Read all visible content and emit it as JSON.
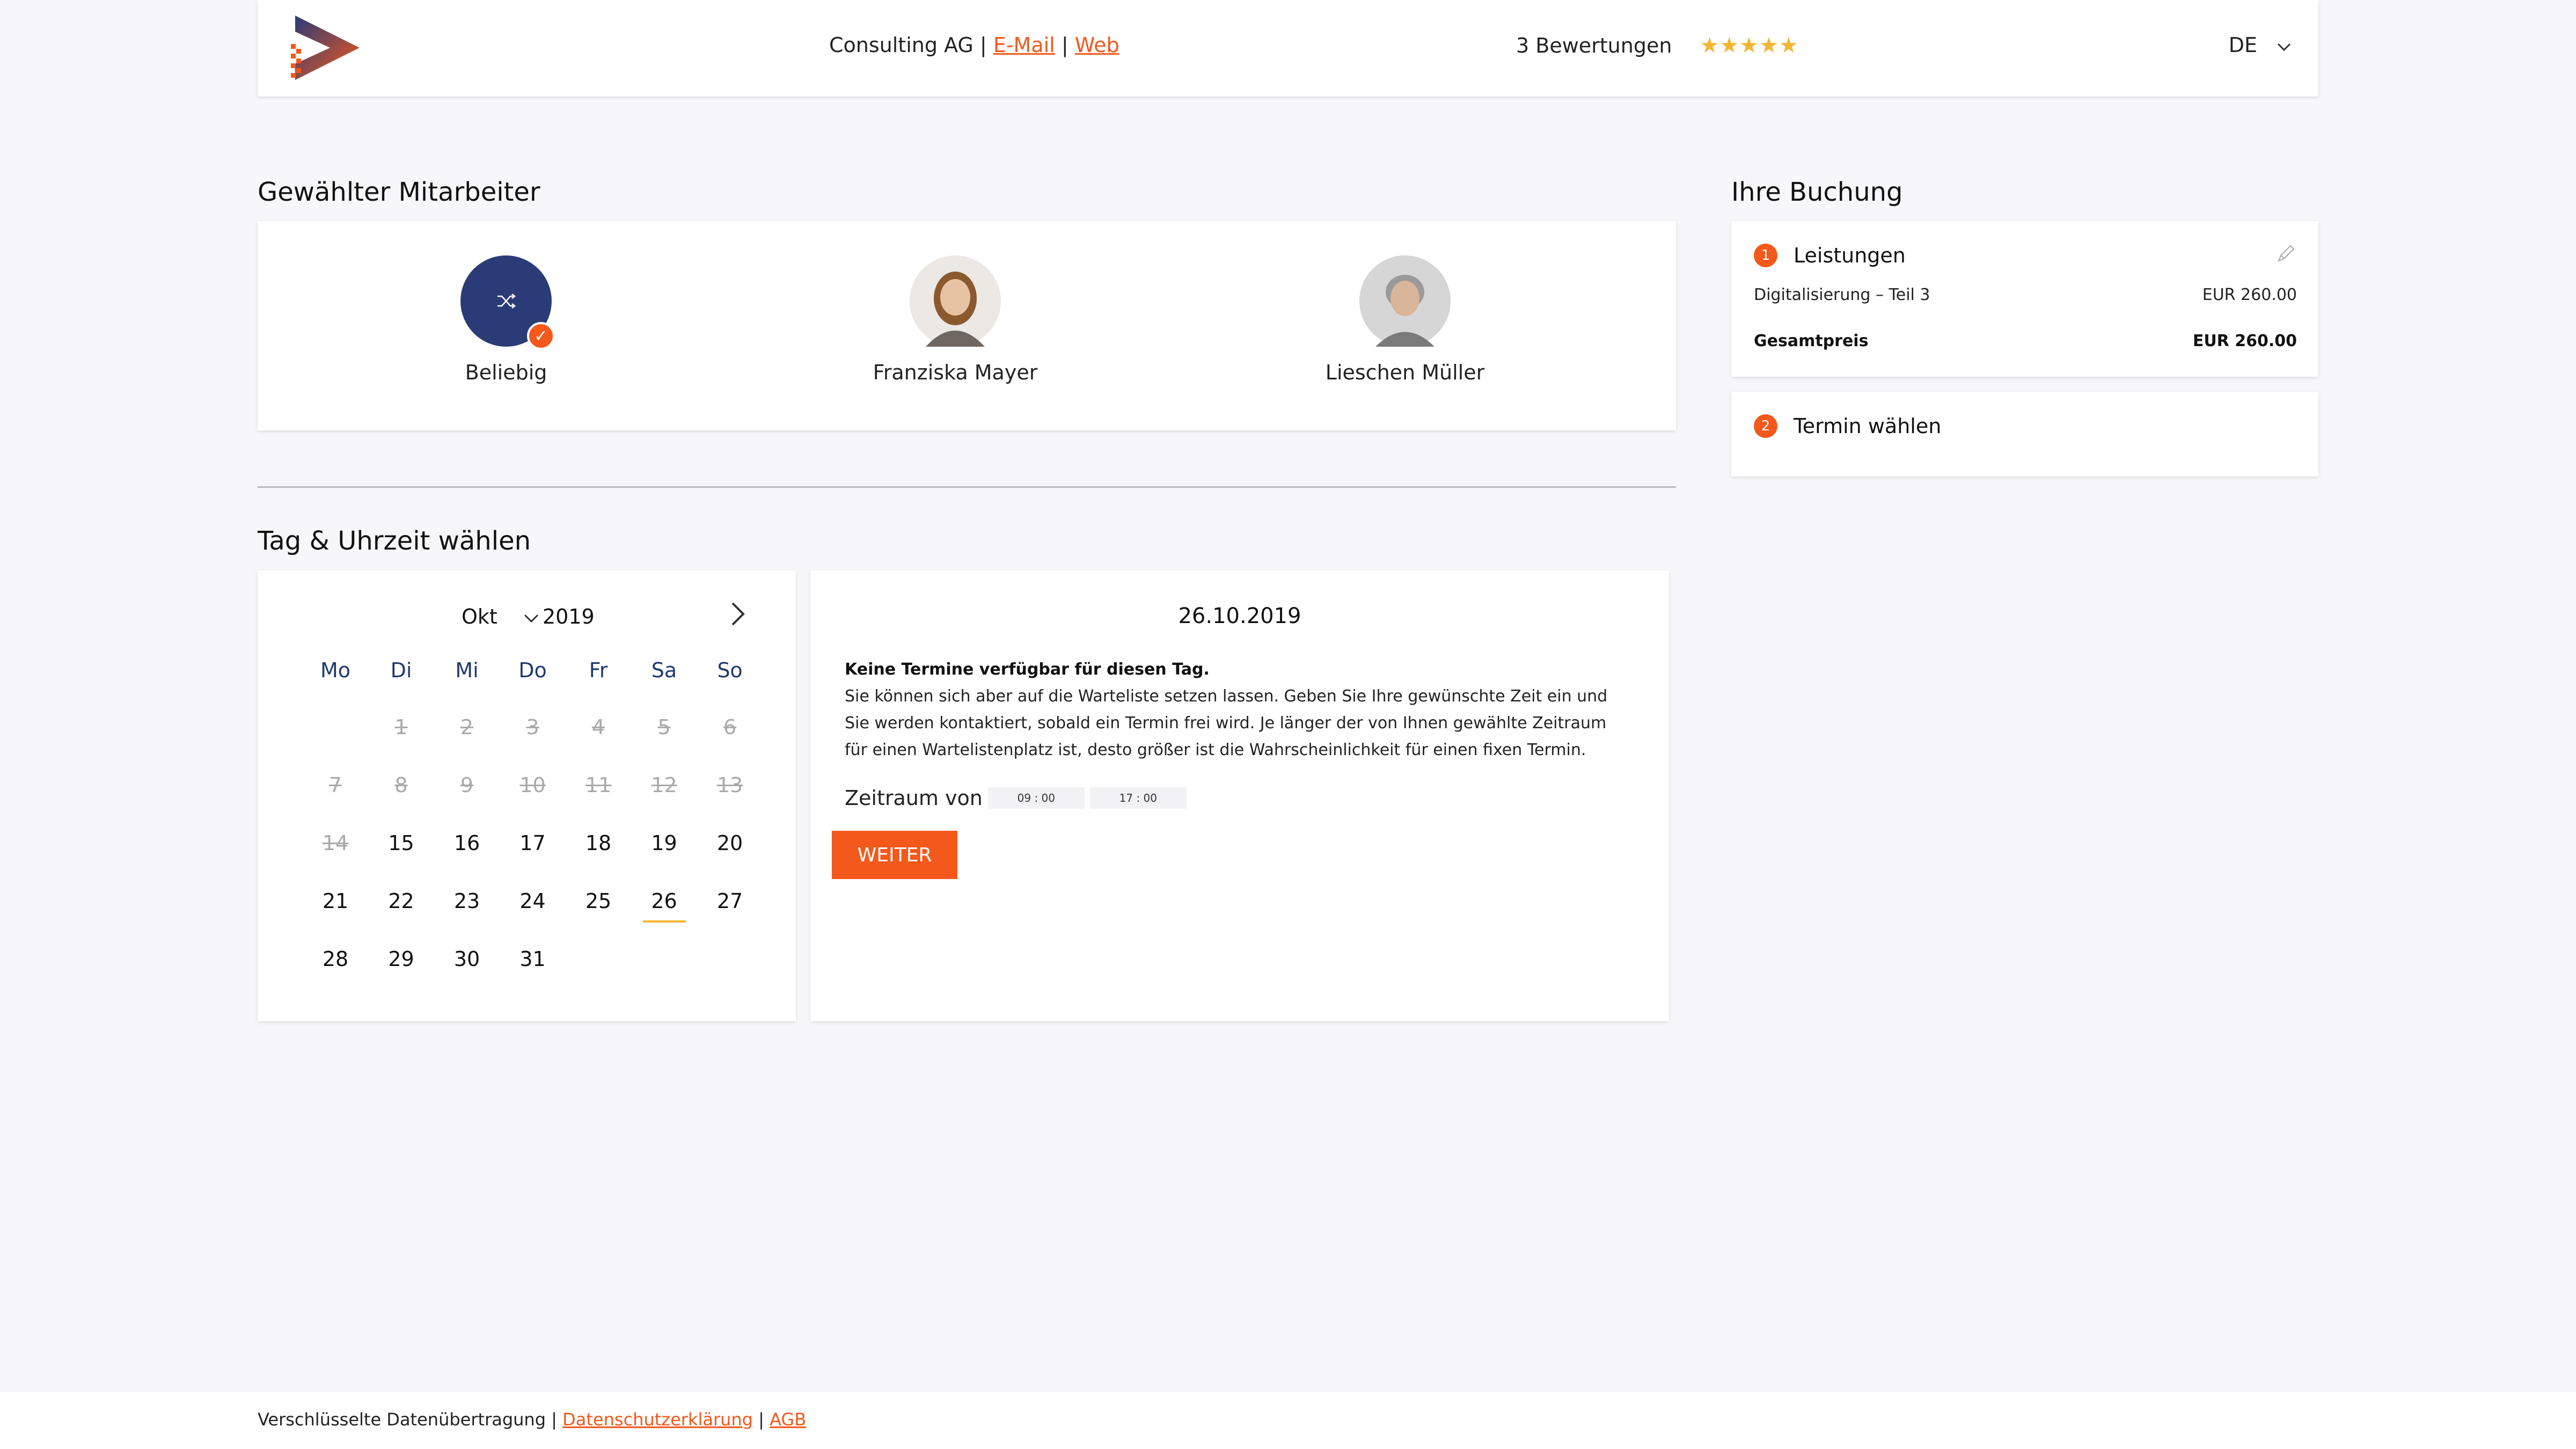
{
  "header": {
    "company": "Consulting AG",
    "email_label": "E-Mail",
    "web_label": "Web",
    "separator": "|",
    "ratings": "3 Bewertungen",
    "stars": "★★★★★",
    "rating_value": 4.5,
    "language": "DE"
  },
  "employees": {
    "title": "Gewählter Mitarbeiter",
    "items": [
      {
        "name": "Beliebig",
        "selected": true
      },
      {
        "name": "Franziska Mayer",
        "selected": false
      },
      {
        "name": "Lieschen Müller",
        "selected": false
      }
    ]
  },
  "calendar": {
    "title": "Tag & Uhrzeit wählen",
    "month": "Okt",
    "year": "2019",
    "weekdays": [
      "Mo",
      "Di",
      "Mi",
      "Do",
      "Fr",
      "Sa",
      "So"
    ],
    "past_days": [
      "1",
      "2",
      "3",
      "4",
      "5",
      "6",
      "7",
      "8",
      "9",
      "10",
      "11",
      "12",
      "13",
      "14"
    ],
    "days_row3": [
      "15",
      "16",
      "17",
      "18",
      "19",
      "20"
    ],
    "days_row4": [
      "21",
      "22",
      "23",
      "24",
      "25",
      "26",
      "27"
    ],
    "days_row5": [
      "28",
      "29",
      "30",
      "31"
    ],
    "selected_day": "26"
  },
  "slots": {
    "date": "26.10.2019",
    "no_slots": "Keine Termine verfügbar für diesen Tag.",
    "waitlist_text": "Sie können sich aber auf die Warteliste setzen lassen. Geben Sie Ihre gewünschte Zeit ein und Sie werden kontaktiert, sobald ein Termin frei wird. Je länger der von Ihnen gewählte Zeitraum für einen Wartelistenplatz ist, desto größer ist die Wahrscheinlichkeit für einen fixen Termin.",
    "range_label": "Zeitraum von",
    "time_from": "09 : 00",
    "time_to": "17 : 00",
    "button": "WEITER"
  },
  "booking": {
    "title": "Ihre Buchung",
    "step1_num": "1",
    "step1_label": "Leistungen",
    "service": "Digitalisierung – Teil 3",
    "service_price": "EUR 260.00",
    "total_label": "Gesamtpreis",
    "total_price": "EUR 260.00",
    "step2_num": "2",
    "step2_label": "Termin wählen"
  },
  "footer": {
    "encrypted": "Verschlüsselte Datenübertragung",
    "privacy": "Datenschutzerklärung",
    "terms": "AGB",
    "separator": "|"
  },
  "colors": {
    "accent": "#f4581b",
    "navy": "#2b3b77",
    "star": "#f5b431"
  }
}
